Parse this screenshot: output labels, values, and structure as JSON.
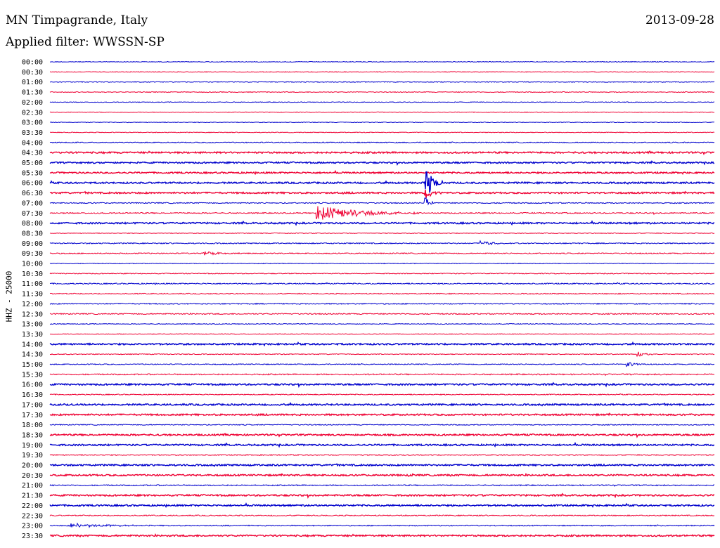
{
  "header": {
    "station": "MN Timpagrande, Italy",
    "date": "2013-09-28",
    "filter": "Applied filter: WWSSN-SP",
    "channel_label": "HHZ - 25000"
  },
  "colors": {
    "even_row": "#0000cc",
    "odd_row": "#ee0033",
    "axis_text": "#000000"
  },
  "chart_data": {
    "type": "line",
    "title": "",
    "ylabel": "HHZ - 25000",
    "rows": [
      "00:00",
      "00:30",
      "01:00",
      "01:30",
      "02:00",
      "02:30",
      "03:00",
      "03:30",
      "04:00",
      "04:30",
      "05:00",
      "05:30",
      "06:00",
      "06:30",
      "07:00",
      "07:30",
      "08:00",
      "08:30",
      "09:00",
      "09:30",
      "10:00",
      "10:30",
      "11:00",
      "11:30",
      "12:00",
      "12:30",
      "13:00",
      "13:30",
      "14:00",
      "14:30",
      "15:00",
      "15:30",
      "16:00",
      "16:30",
      "17:00",
      "17:30",
      "18:00",
      "18:30",
      "19:00",
      "19:30",
      "20:00",
      "20:30",
      "21:00",
      "21:30",
      "22:00",
      "22:30",
      "23:00",
      "23:30"
    ],
    "row_duration_minutes": 30,
    "noise_level": [
      0.1,
      0.1,
      0.2,
      0.2,
      0.1,
      0.1,
      0.1,
      0.1,
      0.4,
      1.0,
      0.9,
      0.9,
      1.0,
      1.0,
      0.5,
      0.6,
      1.0,
      0.1,
      0.5,
      0.5,
      0.2,
      0.3,
      0.6,
      0.4,
      0.5,
      0.6,
      0.2,
      0.1,
      1.0,
      0.3,
      0.4,
      0.7,
      1.0,
      0.4,
      1.0,
      1.0,
      0.4,
      1.0,
      1.0,
      0.4,
      1.0,
      1.0,
      0.6,
      1.0,
      1.0,
      0.5,
      0.5,
      1.0
    ],
    "events": [
      {
        "row": "06:00",
        "minute_in_row": 17.0,
        "peak_amplitude": 2.4,
        "duration_minutes": 0.8
      },
      {
        "row": "06:30",
        "minute_in_row": 17.0,
        "peak_amplitude": 1.0,
        "duration_minutes": 0.8
      },
      {
        "row": "07:00",
        "minute_in_row": 17.0,
        "peak_amplitude": 0.9,
        "duration_minutes": 0.3
      },
      {
        "row": "07:30",
        "minute_in_row": 12.1,
        "peak_amplitude": 1.2,
        "duration_minutes": 5.0
      },
      {
        "row": "09:00",
        "minute_in_row": 19.5,
        "peak_amplitude": 0.4,
        "duration_minutes": 1.5
      },
      {
        "row": "09:30",
        "minute_in_row": 7.0,
        "peak_amplitude": 0.3,
        "duration_minutes": 1.8
      },
      {
        "row": "14:30",
        "minute_in_row": 26.6,
        "peak_amplitude": 0.4,
        "duration_minutes": 0.8
      },
      {
        "row": "15:00",
        "minute_in_row": 26.1,
        "peak_amplitude": 0.4,
        "duration_minutes": 0.8
      },
      {
        "row": "23:00",
        "minute_in_row": 1.0,
        "peak_amplitude": 0.4,
        "duration_minutes": 3.8
      }
    ]
  }
}
